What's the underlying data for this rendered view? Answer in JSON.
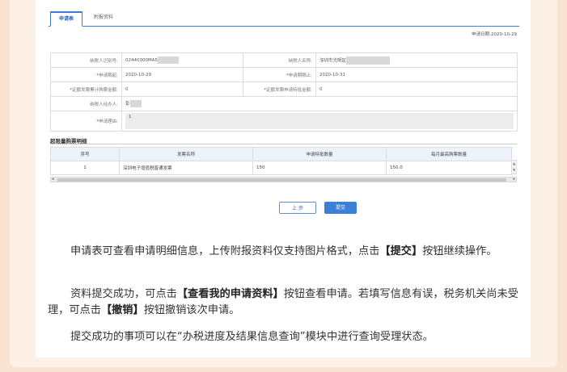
{
  "tabs": [
    {
      "label": "申请表"
    },
    {
      "label": "附报资料"
    }
  ],
  "apply_date": "申请日期:2020-10-29",
  "form": {
    "taxpayer_id_label": "纳税人识别号:",
    "taxpayer_id_value": "02440300MA5",
    "taxpayer_name_label": "纳税人名称:",
    "taxpayer_name_value": "深圳市光明区",
    "start_label": "申请期起:",
    "start_value": "2020-10-29",
    "end_label": "申请期限止:",
    "end_value": "2020-10-31",
    "total_amount_label": "定额发票累计购票金额:",
    "total_amount_value": "0",
    "approve_amount_label": "定额发票申请特批金额:",
    "approve_amount_value": "0",
    "operator_label": "纳税人经办人:",
    "operator_value": "彭",
    "reason_label": "申请理由:",
    "reason_value": "1"
  },
  "section_title": "超限量购票明细",
  "grid": {
    "headers": [
      "序号",
      "发票名称",
      "申请特批数量",
      "每月最高购票数量"
    ],
    "rows": [
      [
        "1",
        "深圳电子增值税普通发票",
        "150",
        "150.0"
      ]
    ]
  },
  "buttons": {
    "prev": "上 步",
    "submit": "提交"
  },
  "paragraphs": {
    "p1_a": "申请表可查看申请明细信息，上传附报资料仅支持图片格式，点击",
    "p1_b": "【提交】",
    "p1_c": "按钮继续操作。",
    "p2_a": "资料提交成功，可点击",
    "p2_b": "【查看我的申请资料】",
    "p2_c": "按钮查看申请。若填写信息有误，税务机关尚未受理，可点击",
    "p2_d": "【撤销】",
    "p2_e": "按钮撤销该次申请。",
    "p3": "提交成功的事项可以在“办税进度及结果信息查询”模块中进行查询受理状态。"
  }
}
